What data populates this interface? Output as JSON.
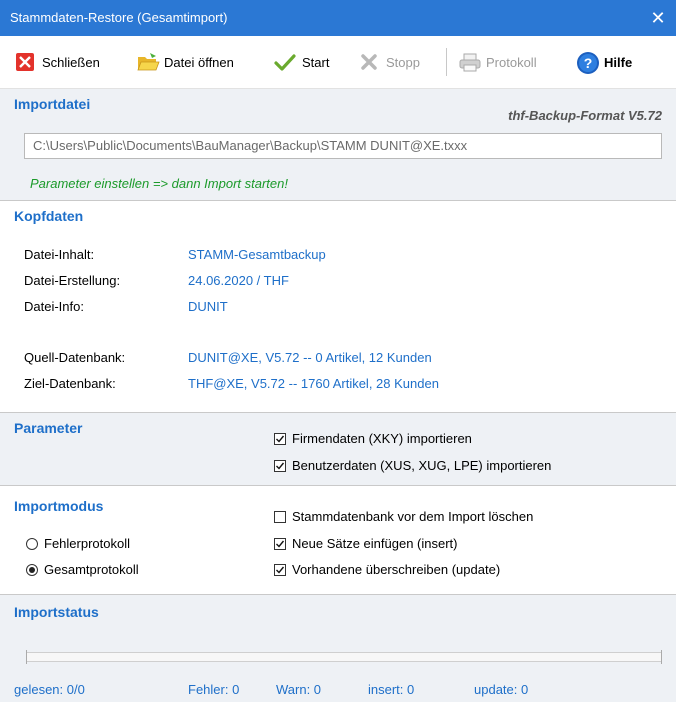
{
  "window": {
    "title": "Stammdaten-Restore (Gesamtimport)",
    "close_glyph": "✕"
  },
  "toolbar": {
    "close_label": "Schließen",
    "open_label": "Datei öffnen",
    "start_label": "Start",
    "stop_label": "Stopp",
    "protocol_label": "Protokoll",
    "help_label": "Hilfe"
  },
  "importdatei": {
    "title": "Importdatei",
    "format": "thf-Backup-Format V5.72",
    "path": "C:\\Users\\Public\\Documents\\BauManager\\Backup\\STAMM DUNIT@XE.txxx",
    "hint": "Parameter einstellen => dann Import starten!"
  },
  "kopfdaten": {
    "title": "Kopfdaten",
    "rows": [
      {
        "label": "Datei-Inhalt:",
        "value": "STAMM-Gesamtbackup"
      },
      {
        "label": "Datei-Erstellung:",
        "value": "24.06.2020 / THF"
      },
      {
        "label": "Datei-Info:",
        "value": "DUNIT"
      },
      {
        "label": "Quell-Datenbank:",
        "value": "DUNIT@XE, V5.72 -- 0 Artikel, 12 Kunden"
      },
      {
        "label": "Ziel-Datenbank:",
        "value": "THF@XE, V5.72 -- 1760 Artikel, 28 Kunden"
      }
    ]
  },
  "parameter": {
    "title": "Parameter",
    "options": [
      {
        "label": "Firmendaten (XKY) importieren",
        "checked": true
      },
      {
        "label": "Benutzerdaten (XUS, XUG, LPE) importieren",
        "checked": true
      }
    ]
  },
  "importmodus": {
    "title": "Importmodus",
    "radios": [
      {
        "label": "Fehlerprotokoll",
        "selected": false
      },
      {
        "label": "Gesamtprotokoll",
        "selected": true
      }
    ],
    "options": [
      {
        "label": "Stammdatenbank vor dem Import löschen",
        "checked": false
      },
      {
        "label": "Neue Sätze einfügen (insert)",
        "checked": true
      },
      {
        "label": "Vorhandene überschreiben (update)",
        "checked": true
      }
    ]
  },
  "importstatus": {
    "title": "Importstatus",
    "progress": 0,
    "gelesen": "gelesen: 0/0",
    "fehler": "Fehler: 0",
    "warn": "Warn: 0",
    "insert": "insert: 0",
    "update": "update: 0"
  },
  "colors": {
    "titlebar": "#2b78d4",
    "accent": "#1e6fc9",
    "hint": "#1b9a2a",
    "section_bg": "#eef1f5"
  }
}
